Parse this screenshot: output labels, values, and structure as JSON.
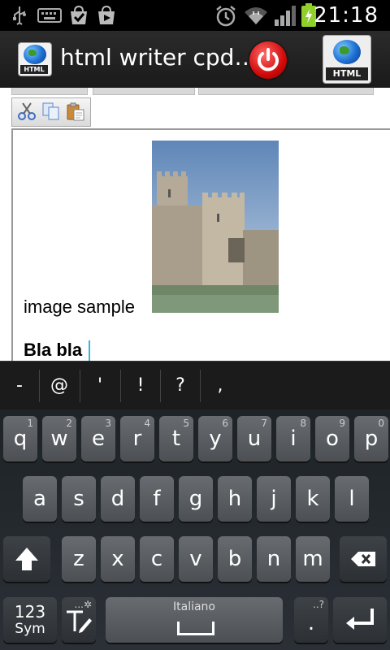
{
  "status_bar": {
    "time": "21:18",
    "icons": [
      "usb-icon",
      "keyboard-icon",
      "task-check-icon",
      "play-store-icon",
      "alarm-icon",
      "wifi-icon",
      "signal-icon",
      "battery-charging-icon"
    ]
  },
  "app_bar": {
    "title": "html writer cpd…",
    "icons": [
      "app-logo-icon",
      "power-icon",
      "html-globe-icon"
    ],
    "logo_badge": "HTML",
    "html_button_badge": "HTML"
  },
  "toolbar": {
    "buttons": [
      "cut-icon",
      "copy-icon",
      "paste-icon"
    ]
  },
  "editor": {
    "image_caption": "image sample",
    "bold_text": "Bla bla",
    "image": "castle-photo"
  },
  "suggestions": [
    "-",
    "@",
    "'",
    "!",
    "?",
    ","
  ],
  "keyboard": {
    "row1": [
      {
        "key": "q",
        "hint": "1"
      },
      {
        "key": "w",
        "hint": "2"
      },
      {
        "key": "e",
        "hint": "3"
      },
      {
        "key": "r",
        "hint": "4"
      },
      {
        "key": "t",
        "hint": "5"
      },
      {
        "key": "y",
        "hint": "6"
      },
      {
        "key": "u",
        "hint": "7"
      },
      {
        "key": "i",
        "hint": "8"
      },
      {
        "key": "o",
        "hint": "9"
      },
      {
        "key": "p",
        "hint": "0"
      }
    ],
    "row2": [
      "a",
      "s",
      "d",
      "f",
      "g",
      "h",
      "j",
      "k",
      "l"
    ],
    "row3": [
      "z",
      "x",
      "c",
      "v",
      "b",
      "n",
      "m"
    ],
    "symbols_key": {
      "top": "123",
      "bottom": "Sym"
    },
    "space_language": "Italiano",
    "period_key": ".",
    "period_hint": "..?",
    "settings_hint": "...✲",
    "icons": [
      "shift-icon",
      "backspace-icon",
      "handwriting-icon",
      "enter-icon"
    ]
  },
  "colors": {
    "accent": "#33b5e5",
    "power": "#d10a0a",
    "keyboard_bg": "#25292d"
  }
}
